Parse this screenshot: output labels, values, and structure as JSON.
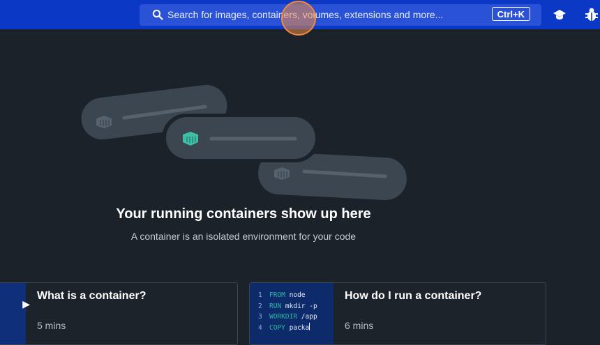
{
  "header": {
    "search_placeholder": "Search for images, containers, volumes, extensions and more...",
    "shortcut": "Ctrl+K",
    "icons": [
      "search-icon",
      "learning-center-icon",
      "troubleshoot-bug-icon"
    ],
    "colors": {
      "bar": "#0b39c5",
      "search_bg": "#2a52d6"
    }
  },
  "empty_state": {
    "title": "Your running containers show up here",
    "subtitle": "A container is an isolated environment for your code",
    "icons": [
      "container-icon",
      "container-icon-active",
      "container-icon"
    ],
    "accent": "#3dbfa6"
  },
  "cards": [
    {
      "title": "What is a container?",
      "time": "5 mins"
    },
    {
      "title": "How do I run a container?",
      "time": "6 mins",
      "code_lines": [
        {
          "num": "1",
          "keyword": "FROM",
          "text": "node"
        },
        {
          "num": "2",
          "keyword": "RUN",
          "text": "mkdir -p"
        },
        {
          "num": "3",
          "keyword": "WORKDIR",
          "text": "/app"
        },
        {
          "num": "4",
          "keyword": "COPY",
          "text": "packa"
        }
      ]
    }
  ]
}
